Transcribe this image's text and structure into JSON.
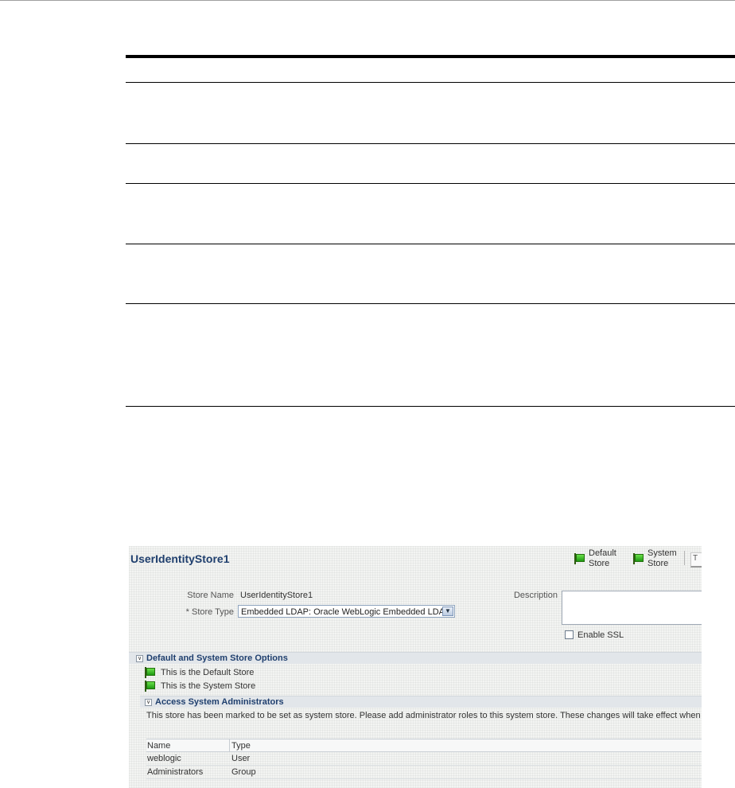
{
  "store": {
    "title": "UserIdentityStore1",
    "header_buttons": [
      {
        "line1": "Default",
        "line2": "Store"
      },
      {
        "line1": "System",
        "line2": "Store"
      }
    ],
    "tab_glyph": "T"
  },
  "form": {
    "store_name_label": "Store Name",
    "store_name_value": "UserIdentityStore1",
    "store_type_label": "* Store Type",
    "store_type_value": "Embedded LDAP: Oracle WebLogic Embedded LDAP",
    "description_label": "Description",
    "description_value": "",
    "enable_ssl_label": "Enable SSL",
    "enable_ssl_checked": false
  },
  "default_system_section": {
    "title": "Default and System Store Options",
    "items": [
      "This is the Default Store",
      "This is the System Store"
    ]
  },
  "admins_section": {
    "title": "Access System Administrators",
    "message": "This store has been marked to be set as system store. Please add administrator roles to this system store. These changes will take effect when y",
    "columns": [
      "Name",
      "Type"
    ],
    "rows": [
      {
        "name": "weblogic",
        "type": "User"
      },
      {
        "name": "Administrators",
        "type": "Group"
      }
    ]
  },
  "colors": {
    "title_blue": "#1f3f6e",
    "flag_green": "#1e9a12"
  },
  "icons": [
    "flag-icon",
    "chevron-down-icon",
    "disclosure-icon",
    "checkbox-icon"
  ]
}
